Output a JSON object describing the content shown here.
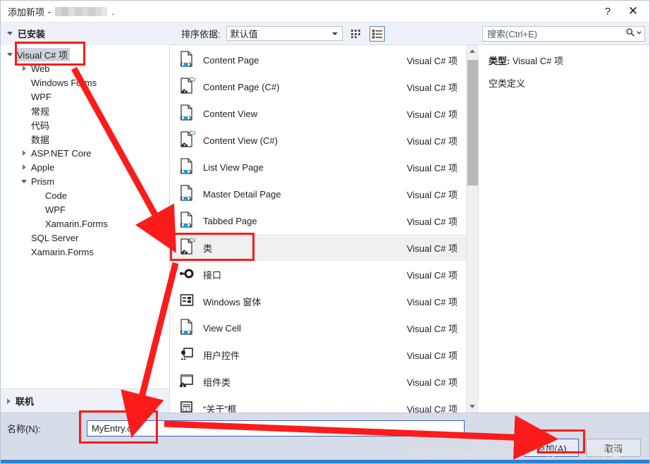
{
  "window": {
    "title_prefix": "添加新项",
    "title_separator": "-",
    "title_project_redacted": "",
    "title_suffix": ".",
    "help_icon": "?",
    "close_icon": "✕"
  },
  "toolbar": {
    "installed_label": "已安装",
    "sort_label": "排序依据:",
    "sort_value": "默认值",
    "grid_view_icon": "grid-view-icon",
    "list_view_icon": "list-view-icon",
    "list_view_active": true
  },
  "search": {
    "placeholder": "搜索(Ctrl+E)",
    "icon": "search-icon",
    "dropdown_icon": "chevron-down-icon"
  },
  "tree": {
    "nodes": [
      {
        "label": "Visual C# 项",
        "depth": 0,
        "expander": "down",
        "selected": true
      },
      {
        "label": "Web",
        "depth": 1,
        "expander": "right",
        "selected": false
      },
      {
        "label": "Windows Forms",
        "depth": 1,
        "expander": "none",
        "selected": false
      },
      {
        "label": "WPF",
        "depth": 1,
        "expander": "none",
        "selected": false
      },
      {
        "label": "常规",
        "depth": 1,
        "expander": "none",
        "selected": false
      },
      {
        "label": "代码",
        "depth": 1,
        "expander": "none",
        "selected": false
      },
      {
        "label": "数据",
        "depth": 1,
        "expander": "none",
        "selected": false
      },
      {
        "label": "ASP.NET Core",
        "depth": 1,
        "expander": "right",
        "selected": false
      },
      {
        "label": "Apple",
        "depth": 1,
        "expander": "right",
        "selected": false
      },
      {
        "label": "Prism",
        "depth": 1,
        "expander": "down",
        "selected": false
      },
      {
        "label": "Code",
        "depth": 2,
        "expander": "none",
        "selected": false
      },
      {
        "label": "WPF",
        "depth": 2,
        "expander": "none",
        "selected": false
      },
      {
        "label": "Xamarin.Forms",
        "depth": 2,
        "expander": "none",
        "selected": false
      },
      {
        "label": "SQL Server",
        "depth": 1,
        "expander": "none",
        "selected": false
      },
      {
        "label": "Xamarin.Forms",
        "depth": 1,
        "expander": "none",
        "selected": false
      }
    ],
    "online_label": "联机"
  },
  "item_list": {
    "items": [
      {
        "name": "Content Page",
        "kind": "Visual C# 项",
        "icon": "page-xaml-icon",
        "selected": false
      },
      {
        "name": "Content Page (C#)",
        "kind": "Visual C# 项",
        "icon": "page-csharp-icon",
        "selected": false
      },
      {
        "name": "Content View",
        "kind": "Visual C# 项",
        "icon": "page-xaml-icon",
        "selected": false
      },
      {
        "name": "Content View (C#)",
        "kind": "Visual C# 项",
        "icon": "page-csharp-icon",
        "selected": false
      },
      {
        "name": "List View Page",
        "kind": "Visual C# 项",
        "icon": "page-xaml-icon",
        "selected": false
      },
      {
        "name": "Master Detail Page",
        "kind": "Visual C# 项",
        "icon": "page-xaml-icon",
        "selected": false
      },
      {
        "name": "Tabbed Page",
        "kind": "Visual C# 项",
        "icon": "page-xaml-icon",
        "selected": false
      },
      {
        "name": "类",
        "kind": "Visual C# 项",
        "icon": "class-csharp-icon",
        "selected": true
      },
      {
        "name": "接口",
        "kind": "Visual C# 项",
        "icon": "interface-icon",
        "selected": false
      },
      {
        "name": "Windows 窗体",
        "kind": "Visual C# 项",
        "icon": "windows-form-icon",
        "selected": false
      },
      {
        "name": "View Cell",
        "kind": "Visual C# 项",
        "icon": "page-xaml-icon",
        "selected": false
      },
      {
        "name": "用户控件",
        "kind": "Visual C# 项",
        "icon": "user-control-icon",
        "selected": false
      },
      {
        "name": "组件类",
        "kind": "Visual C# 项",
        "icon": "component-class-icon",
        "selected": false
      },
      {
        "name": "“关于”框",
        "kind": "Visual C# 项",
        "icon": "about-box-icon",
        "selected": false
      }
    ]
  },
  "details": {
    "type_label": "类型:",
    "type_value": "Visual C# 项",
    "description": "空类定义"
  },
  "footer": {
    "name_label": "名称(N):",
    "name_value": "MyEntry.cs",
    "add_button": "添加(A)",
    "add_button_plain": "添加",
    "add_button_accel": "A",
    "cancel_button": "取消"
  },
  "watermark": {
    "text": "https://blog.csdn.net/mg5l0ll0l博客"
  },
  "colors": {
    "annotation_red": "#fc1b1b",
    "selection_gray": "#f0f0f0",
    "tree_selection": "#cdd4de",
    "accent_blue": "#2f7fd4",
    "footer_bg": "#d6dce8",
    "toolbar_bg": "#eef1f7"
  }
}
